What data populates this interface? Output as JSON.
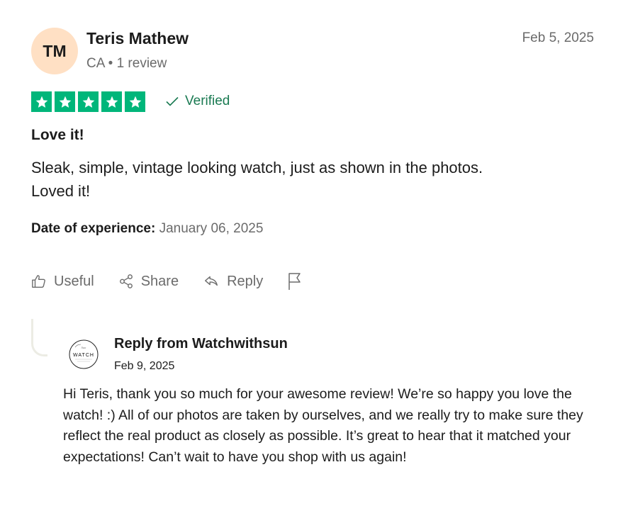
{
  "review": {
    "initials": "TM",
    "name": "Teris Mathew",
    "country": "CA",
    "review_count": "1 review",
    "date": "Feb 5, 2025",
    "rating": 5,
    "verified_label": "Verified",
    "title": "Love it!",
    "body_line1": "Sleak, simple, vintage looking watch, just as shown in the photos.",
    "body_line2": "Loved it!",
    "experience_label": "Date of experience:",
    "experience_date": "January 06, 2025"
  },
  "actions": {
    "useful_label": "Useful",
    "share_label": "Share",
    "reply_label": "Reply"
  },
  "reply": {
    "from": "Reply from Watchwithsun",
    "date": "Feb 9, 2025",
    "logo_text": "WATCH",
    "text": "Hi Teris, thank you so much for your awesome review! We’re so happy you love the watch! :) All of our photos are taken by ourselves, and we really try to make sure they reflect the real product as closely as possible. It’s great to hear that it matched your expectations! Can’t wait to have you shop with us again!"
  },
  "colors": {
    "star_green": "#00b67a",
    "verified_green": "#1a7a52",
    "avatar_bg": "#ffe0c4",
    "muted_text": "#6b6b6b"
  }
}
